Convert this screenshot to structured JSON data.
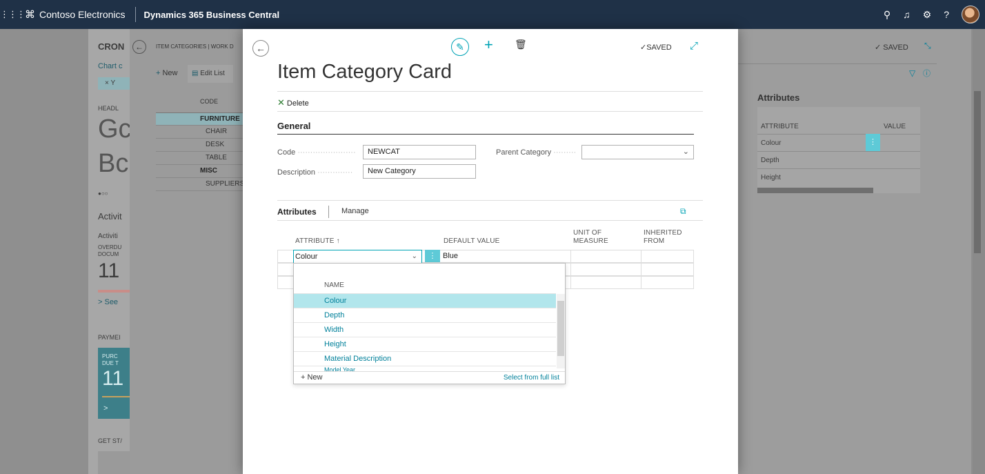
{
  "topbar": {
    "company": "Contoso Electronics",
    "product": "Dynamics 365 Business Central",
    "icons": [
      "app-launcher-icon",
      "search-icon",
      "bell-icon",
      "gear-icon",
      "help-icon",
      "avatar"
    ]
  },
  "role_center": {
    "title": "CRON",
    "chart_link": "Chart c",
    "filter_chip": "× Y",
    "headline_label": "HEADL",
    "headline_text_1": "Gc",
    "headline_text_2": "Bc",
    "pager": "●○○",
    "activities_title": "Activit",
    "activities_sub": "Activiti",
    "overdue_label_1": "OVERDU",
    "overdue_label_2": "DOCUM",
    "overdue_value": "11",
    "see_more": "> See",
    "payments_label": "PAYMEI",
    "purchase_label_1": "PURC",
    "purchase_label_2": "DUE T",
    "purchase_value": "11",
    "tile_chevron": ">",
    "get_started": "GET ST/"
  },
  "list_page": {
    "breadcrumb": "ITEM CATEGORIES | WORK D",
    "new_label": "New",
    "edit_list_label": "Edit List",
    "code_header": "CODE",
    "rows": [
      "FURNITURE",
      "CHAIR",
      "DESK",
      "TABLE",
      "MISC",
      "SUPPLIERS"
    ]
  },
  "card": {
    "title": "Item Category Card",
    "saved": "SAVED",
    "delete_label": "Delete",
    "general_title": "General",
    "code_label": "Code",
    "code_value": "NEWCAT",
    "description_label": "Description",
    "description_value": "New Category",
    "parent_category_label": "Parent Category",
    "parent_category_value": "",
    "attributes_title": "Attributes",
    "manage_label": "Manage",
    "col_attribute": "ATTRIBUTE ↑",
    "col_default_value": "DEFAULT VALUE",
    "col_uom_1": "UNIT OF",
    "col_uom_2": "MEASURE",
    "col_inherited_1": "INHERITED",
    "col_inherited_2": "FROM",
    "row1_attribute": "Colour",
    "row1_default_value": "Blue",
    "dropdown": {
      "header": "NAME",
      "items": [
        "Colour",
        "Depth",
        "Width",
        "Height",
        "Material Description",
        "Model Year"
      ],
      "new_label": "New",
      "select_full": "Select from full list"
    }
  },
  "right_page": {
    "saved": "SAVED",
    "attributes_title": "Attributes",
    "col_attribute": "ATTRIBUTE",
    "col_value": "VALUE",
    "rows": [
      "Colour",
      "Depth",
      "Height"
    ]
  }
}
